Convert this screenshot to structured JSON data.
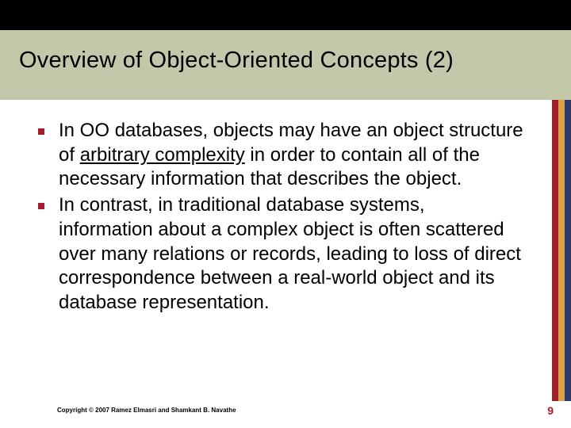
{
  "slide": {
    "title": "Overview of Object-Oriented Concepts (2)",
    "bullets": [
      {
        "pre": "In OO databases, objects may have an object structure of ",
        "underlined": "arbitrary complexity",
        "post": " in order to contain all of the necessary information that describes the object."
      },
      {
        "pre": "In contrast, in traditional database systems, information about a complex object is often scattered over many relations or records, leading to loss of direct correspondence between a real-world object and its database representation.",
        "underlined": "",
        "post": ""
      }
    ],
    "footer": "Copyright © 2007 Ramez Elmasri and Shamkant B. Navathe",
    "page_number": "9"
  },
  "colors": {
    "accent_red": "#a11f2a",
    "accent_gold": "#d7a24a",
    "accent_blue": "#2e3a6b",
    "title_band": "#c3c8aa"
  }
}
